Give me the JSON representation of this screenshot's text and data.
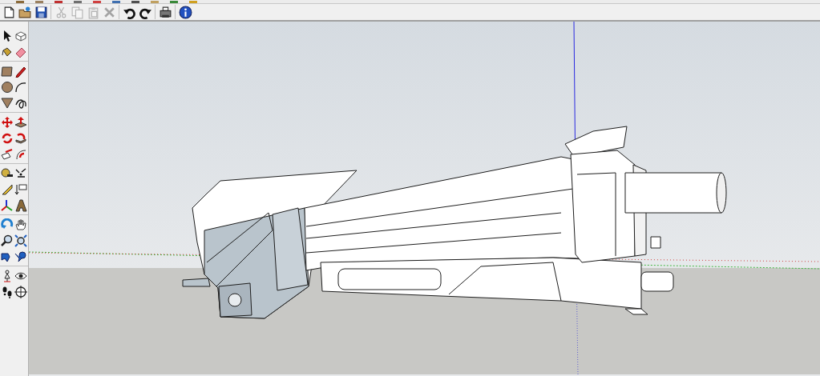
{
  "standard_toolbar": {
    "groups": [
      [
        {
          "kind": "new",
          "disabled": false
        },
        {
          "kind": "open",
          "disabled": false
        },
        {
          "kind": "save",
          "disabled": false
        }
      ],
      [
        {
          "kind": "cut",
          "disabled": true
        },
        {
          "kind": "copy",
          "disabled": true
        },
        {
          "kind": "paste",
          "disabled": true
        },
        {
          "kind": "delete",
          "disabled": true
        }
      ],
      [
        {
          "kind": "undo",
          "disabled": false
        },
        {
          "kind": "redo",
          "disabled": false
        }
      ],
      [
        {
          "kind": "print",
          "disabled": false
        }
      ],
      [
        {
          "kind": "info",
          "disabled": false
        }
      ]
    ]
  },
  "tools_toolbar": {
    "groups": [
      [
        {
          "kind": "select"
        },
        {
          "kind": "component"
        },
        {
          "kind": "paint"
        },
        {
          "kind": "eraser"
        }
      ],
      [
        {
          "kind": "rectangle"
        },
        {
          "kind": "line"
        },
        {
          "kind": "circle"
        },
        {
          "kind": "arc"
        },
        {
          "kind": "polygon"
        },
        {
          "kind": "freehand"
        }
      ],
      [
        {
          "kind": "move"
        },
        {
          "kind": "pushpull"
        },
        {
          "kind": "rotate"
        },
        {
          "kind": "followme"
        },
        {
          "kind": "scale"
        },
        {
          "kind": "offset"
        }
      ],
      [
        {
          "kind": "tape"
        },
        {
          "kind": "dimension"
        },
        {
          "kind": "protractor"
        },
        {
          "kind": "text"
        },
        {
          "kind": "axes"
        },
        {
          "kind": "text3d"
        }
      ],
      [
        {
          "kind": "orbit"
        },
        {
          "kind": "pan"
        },
        {
          "kind": "zoom"
        },
        {
          "kind": "zoomwindow"
        },
        {
          "kind": "previous"
        },
        {
          "kind": "extents"
        }
      ],
      [
        {
          "kind": "position"
        },
        {
          "kind": "lookaround"
        },
        {
          "kind": "walk"
        },
        {
          "kind": "section"
        }
      ]
    ]
  }
}
